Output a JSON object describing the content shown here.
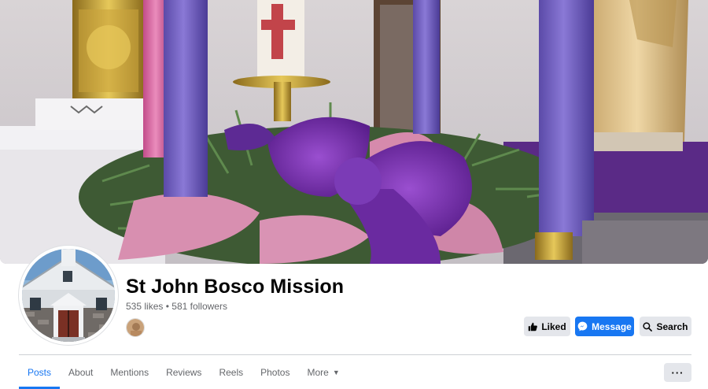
{
  "page": {
    "name": "St John Bosco Mission",
    "likes": "535 likes",
    "separator": "•",
    "followers": "581 followers"
  },
  "actions": {
    "liked_label": "Liked",
    "message_label": "Message",
    "search_label": "Search",
    "more_label": "···"
  },
  "tabs": [
    {
      "label": "Posts",
      "active": true
    },
    {
      "label": "About"
    },
    {
      "label": "Mentions"
    },
    {
      "label": "Reviews"
    },
    {
      "label": "Reels"
    },
    {
      "label": "Photos"
    },
    {
      "label": "More"
    }
  ],
  "colors": {
    "accent": "#1877f2",
    "text_primary": "#050505",
    "text_secondary": "#65676b",
    "button_gray": "#e4e6eb"
  },
  "icons": {
    "liked": "thumbs-up-icon",
    "message": "messenger-icon",
    "search": "search-icon",
    "more_dropdown": "caret-down-icon"
  }
}
